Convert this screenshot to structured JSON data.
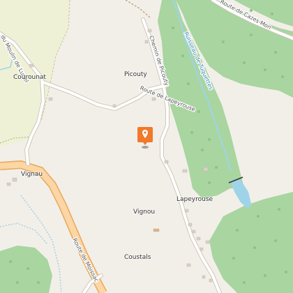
{
  "map": {
    "places": {
      "couroonat": "Courounat",
      "picouty": "Picouty",
      "vignau": "Vignau",
      "lapeyrouse": "Lapeyrouse",
      "vignou": "Vignou",
      "coustals": "Coustals"
    },
    "roads": {
      "route_de_moissac": "Route de Moissac",
      "route_de_lapeyrouse": "Route de Lapeyrouse",
      "chemin_de_picouty": "Chemin de Picouty",
      "route_de_cazes_mondenard": "Route de Cazes Mon",
      "moulin_de_lunel": "du Moulin de Lunel"
    },
    "streams": {
      "ruisseau_de_tuquettes": "Ruisseau de Tuquettes"
    },
    "colors": {
      "land": "#f2efe9",
      "forest": "#a9d5a0",
      "meadow": "#eef1d6",
      "major_road": "#fcd6a4",
      "major_road_casing": "#e8a85a",
      "minor_road": "#ffffff",
      "water": "#9fd4e8",
      "marker": "#f07a2a"
    },
    "icons": {
      "marker": "location-pin-icon"
    }
  }
}
